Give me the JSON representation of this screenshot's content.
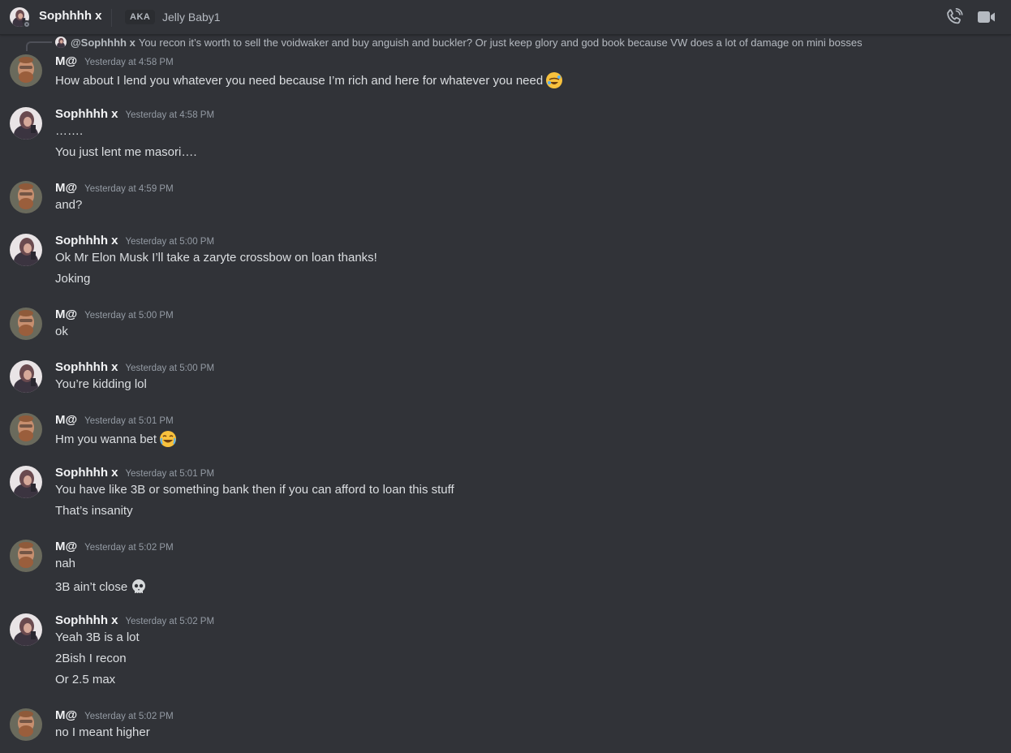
{
  "header": {
    "channel_name": "Sophhhh x",
    "aka_label": "AKA",
    "aka_name": "Jelly Baby1"
  },
  "reply": {
    "user": "@Sophhhh x",
    "text": "You recon it’s worth to sell the voidwaker and buy anguish and buckler? Or just keep glory and god book because VW does a lot of damage on mini bosses"
  },
  "messages": [
    {
      "author": "M@",
      "time": "Yesterday at 4:58 PM",
      "lines": [
        "How about I lend you whatever you need because I’m rich and here for whatever you need"
      ],
      "emoji": "rofl"
    },
    {
      "author": "Sophhhh x",
      "time": "Yesterday at 4:58 PM",
      "lines": [
        "…….",
        "You just lent me masori…."
      ]
    },
    {
      "author": "M@",
      "time": "Yesterday at 4:59 PM",
      "lines": [
        "and?"
      ]
    },
    {
      "author": "Sophhhh x",
      "time": "Yesterday at 5:00 PM",
      "lines": [
        "Ok Mr Elon Musk I’ll take a zaryte crossbow on loan thanks!",
        "Joking"
      ]
    },
    {
      "author": "M@",
      "time": "Yesterday at 5:00 PM",
      "lines": [
        "ok"
      ]
    },
    {
      "author": "Sophhhh x",
      "time": "Yesterday at 5:00 PM",
      "lines": [
        "You’re kidding lol"
      ]
    },
    {
      "author": "M@",
      "time": "Yesterday at 5:01 PM",
      "lines": [
        "Hm you wanna bet"
      ],
      "emoji": "joy"
    },
    {
      "author": "Sophhhh x",
      "time": "Yesterday at 5:01 PM",
      "lines": [
        "You have like 3B or something bank then if you can afford to loan this stuff",
        "That’s insanity"
      ]
    },
    {
      "author": "M@",
      "time": "Yesterday at 5:02 PM",
      "lines": [
        "nah",
        "3B ain’t close"
      ],
      "emoji": "skull"
    },
    {
      "author": "Sophhhh x",
      "time": "Yesterday at 5:02 PM",
      "lines": [
        "Yeah 3B is a lot",
        "2Bish I recon",
        "Or 2.5 max"
      ]
    },
    {
      "author": "M@",
      "time": "Yesterday at 5:02 PM",
      "lines": [
        "no I meant higher"
      ]
    }
  ]
}
